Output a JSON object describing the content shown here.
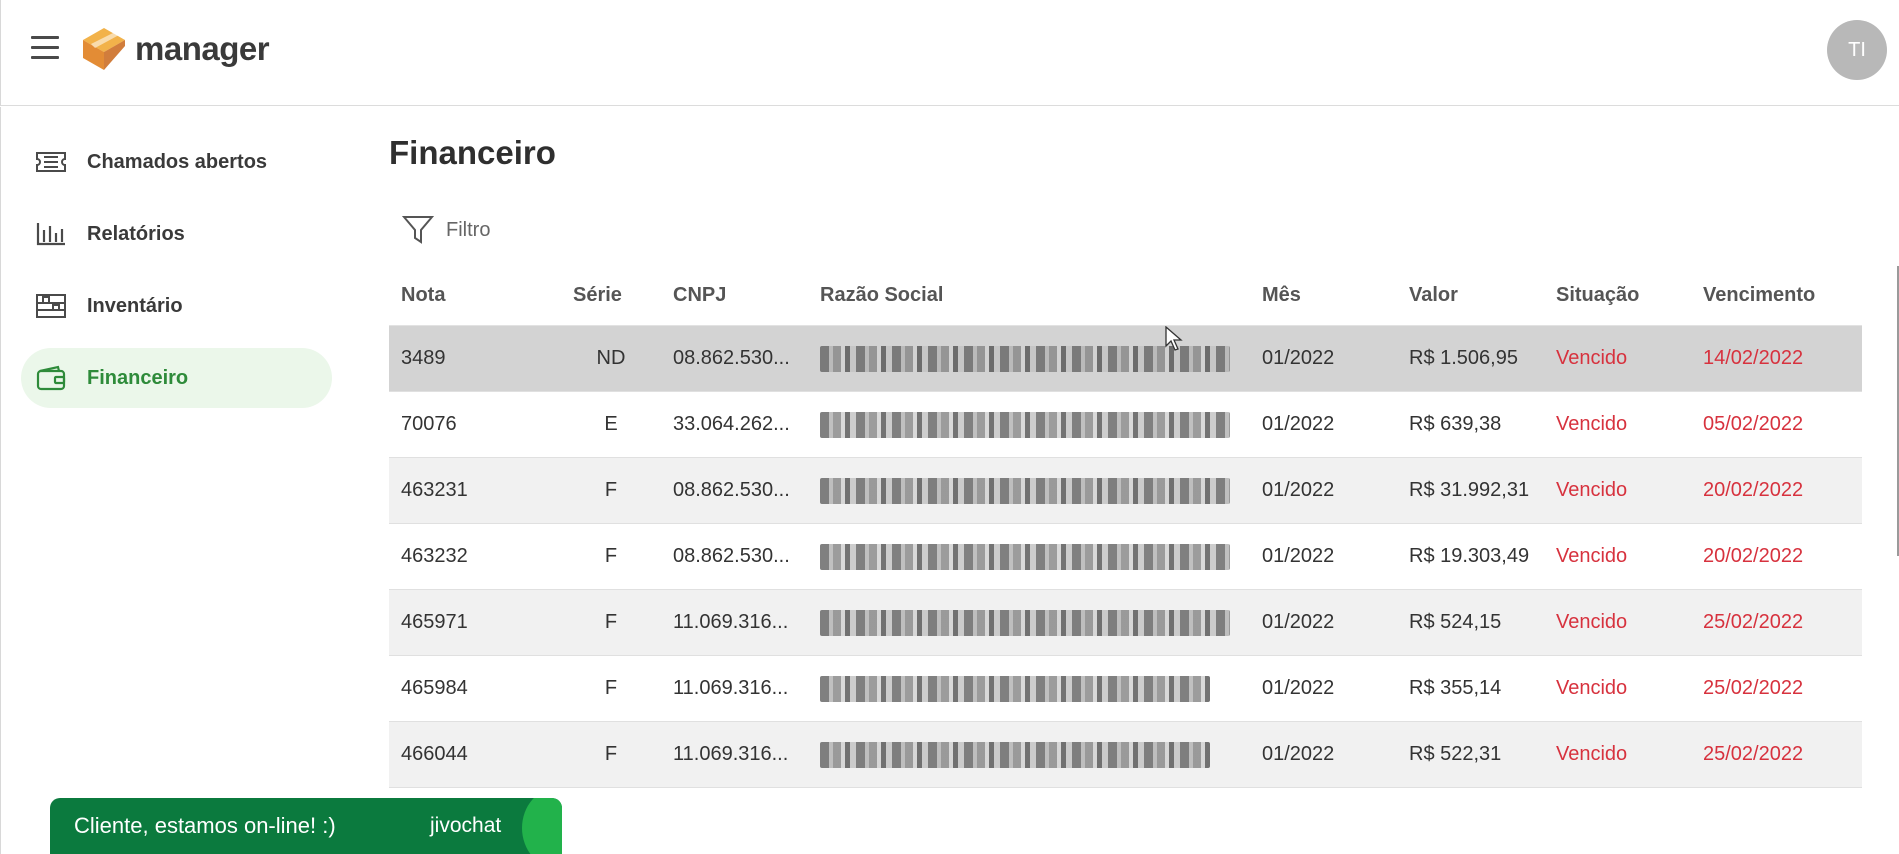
{
  "header": {
    "logo_text": "manager",
    "avatar_initials": "TI"
  },
  "sidebar": {
    "items": [
      {
        "label": "Chamados abertos",
        "icon": "ticket-icon"
      },
      {
        "label": "Relatórios",
        "icon": "bar-chart-icon"
      },
      {
        "label": "Inventário",
        "icon": "warehouse-icon"
      },
      {
        "label": "Financeiro",
        "icon": "wallet-icon",
        "active": true
      }
    ]
  },
  "main": {
    "title": "Financeiro",
    "filter_label": "Filtro",
    "table": {
      "columns": [
        "Nota",
        "Série",
        "CNPJ",
        "Razão Social",
        "Mês",
        "Valor",
        "Situação",
        "Vencimento"
      ],
      "rows": [
        {
          "nota": "3489",
          "serie": "ND",
          "cnpj": "08.862.530...",
          "mes": "01/2022",
          "valor": "R$ 1.506,95",
          "situacao": "Vencido",
          "vencimento": "14/02/2022"
        },
        {
          "nota": "70076",
          "serie": "E",
          "cnpj": "33.064.262...",
          "mes": "01/2022",
          "valor": "R$ 639,38",
          "situacao": "Vencido",
          "vencimento": "05/02/2022"
        },
        {
          "nota": "463231",
          "serie": "F",
          "cnpj": "08.862.530...",
          "mes": "01/2022",
          "valor": "R$ 31.992,31",
          "situacao": "Vencido",
          "vencimento": "20/02/2022"
        },
        {
          "nota": "463232",
          "serie": "F",
          "cnpj": "08.862.530...",
          "mes": "01/2022",
          "valor": "R$ 19.303,49",
          "situacao": "Vencido",
          "vencimento": "20/02/2022"
        },
        {
          "nota": "465971",
          "serie": "F",
          "cnpj": "11.069.316...",
          "mes": "01/2022",
          "valor": "R$ 524,15",
          "situacao": "Vencido",
          "vencimento": "25/02/2022"
        },
        {
          "nota": "465984",
          "serie": "F",
          "cnpj": "11.069.316...",
          "mes": "01/2022",
          "valor": "R$ 355,14",
          "situacao": "Vencido",
          "vencimento": "25/02/2022"
        },
        {
          "nota": "466044",
          "serie": "F",
          "cnpj": "11.069.316...",
          "mes": "01/2022",
          "valor": "R$ 522,31",
          "situacao": "Vencido",
          "vencimento": "25/02/2022"
        }
      ]
    }
  },
  "chat": {
    "text": "Cliente, estamos on-line! :)",
    "brand": "jivochat"
  },
  "colors": {
    "accent_green": "#2e8b3a",
    "active_bg": "#ebf7ea",
    "overdue_red": "#d7323e",
    "chat_green": "#0b7a3e",
    "logo_orange": "#e8992f"
  }
}
